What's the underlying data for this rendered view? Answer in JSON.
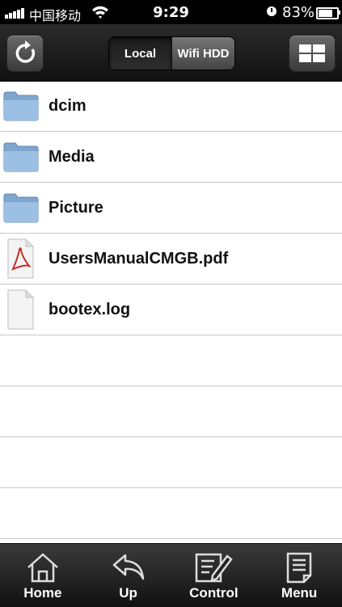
{
  "status_bar": {
    "carrier": "中国移动",
    "time": "9:29",
    "battery_percent": "83%",
    "battery_level": 0.83
  },
  "toolbar": {
    "segments": [
      "Local",
      "Wifi HDD"
    ],
    "selected_segment": "Local"
  },
  "files": [
    {
      "name": "dcim",
      "type": "folder",
      "icon": "folder-icon"
    },
    {
      "name": "Media",
      "type": "folder",
      "icon": "folder-icon"
    },
    {
      "name": "Picture",
      "type": "folder",
      "icon": "folder-icon"
    },
    {
      "name": "UsersManualCMGB.pdf",
      "type": "pdf",
      "icon": "pdf-file-icon"
    },
    {
      "name": "bootex.log",
      "type": "file",
      "icon": "document-file-icon"
    }
  ],
  "tabs": [
    {
      "label": "Home",
      "icon": "home-icon"
    },
    {
      "label": "Up",
      "icon": "up-arrow-icon"
    },
    {
      "label": "Control",
      "icon": "edit-icon"
    },
    {
      "label": "Menu",
      "icon": "menu-document-icon"
    }
  ],
  "colors": {
    "folder": "#8fb4d9",
    "toolbar": "#1c1c1c",
    "divider": "#c8c8c8"
  }
}
